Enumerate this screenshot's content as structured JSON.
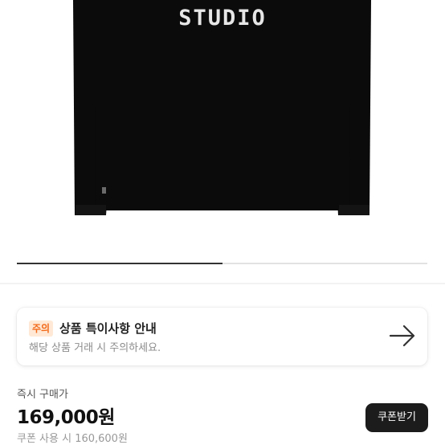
{
  "product": {
    "image_alt": "black long sleeve shirt",
    "print_text": "STUDIO",
    "gallery_progress": 0.5
  },
  "notice": {
    "badge": "주의",
    "title": "상품 특이사항 안내",
    "description": "해당 상품 거래 시 주의하세요.",
    "arrow_icon": "arrow-right-icon"
  },
  "price": {
    "label": "즉시 구매가",
    "value": "169,000원",
    "coupon_text": "쿠폰 사용 시 160,600원"
  },
  "coupon_button": {
    "label": "쿠폰받기"
  },
  "colors": {
    "shirt": "#0b0b0b",
    "badge_bg": "#ffe9d6",
    "badge_text": "#f26a1b",
    "button_bg": "#1c1c1c"
  }
}
